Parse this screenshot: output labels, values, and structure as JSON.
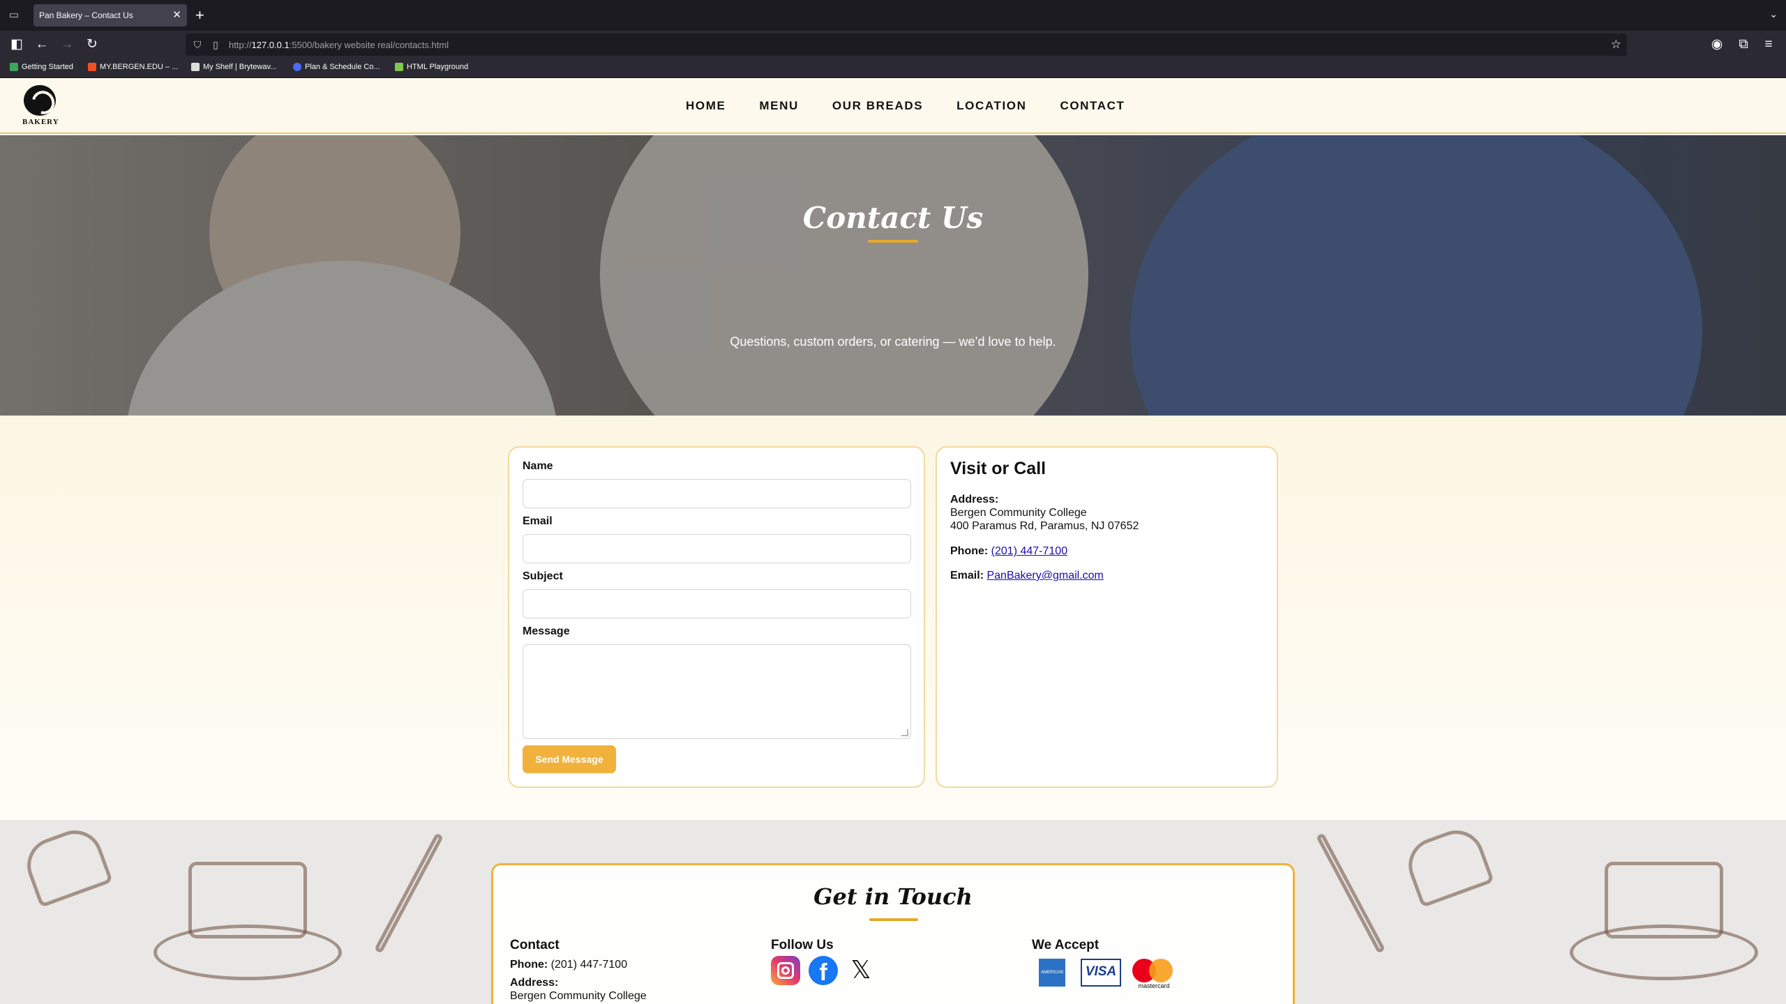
{
  "browser": {
    "tab_title": "Pan Bakery – Contact Us",
    "url_scheme": "http://",
    "url_host": "127.0.0.1",
    "url_rest": ":5500/bakery website real/contacts.html",
    "bookmarks": [
      {
        "label": "Getting Started",
        "color": "#3ba55d"
      },
      {
        "label": "MY.BERGEN.EDU – ...",
        "color": "#f25022"
      },
      {
        "label": "My Shelf | Brytewav...",
        "color": "#dddddd"
      },
      {
        "label": "Plan & Schedule Co...",
        "color": "#4a6cf7"
      },
      {
        "label": "HTML Playground",
        "color": "#7ec850"
      }
    ]
  },
  "site": {
    "logo_text": "BAKERY",
    "nav": [
      "HOME",
      "MENU",
      "OUR BREADS",
      "LOCATION",
      "CONTACT"
    ],
    "hero": {
      "title": "Contact Us",
      "subtitle": "Questions, custom orders, or catering — we’d love to help."
    },
    "form": {
      "name_label": "Name",
      "email_label": "Email",
      "subject_label": "Subject",
      "message_label": "Message",
      "name_value": "",
      "email_value": "",
      "subject_value": "",
      "message_value": "",
      "submit_label": "Send Message"
    },
    "info": {
      "title": "Visit or Call",
      "address_label": "Address:",
      "address_line1": "Bergen Community College",
      "address_line2": "400 Paramus Rd, Paramus, NJ 07652",
      "phone_label": "Phone:",
      "phone": "(201) 447-7100",
      "email_label": "Email:",
      "email": "PanBakery@gmail.com"
    },
    "footer": {
      "title": "Get in Touch",
      "contact_title": "Contact",
      "phone_label": "Phone:",
      "phone": "(201) 447-7100",
      "address_label": "Address:",
      "address_line1": "Bergen Community College",
      "follow_title": "Follow Us",
      "accept_title": "We Accept",
      "amex_text": "AMERICAN EXPRESS",
      "visa_text": "VISA",
      "mastercard_text": "mastercard"
    }
  },
  "colors": {
    "accent": "#f0b23c",
    "rule": "#e8a92a",
    "card_border": "#f1d9a0",
    "link": "#1a0dab"
  },
  "icons": {
    "instagram": "instagram-icon",
    "facebook": "facebook-icon",
    "x": "x-icon"
  }
}
